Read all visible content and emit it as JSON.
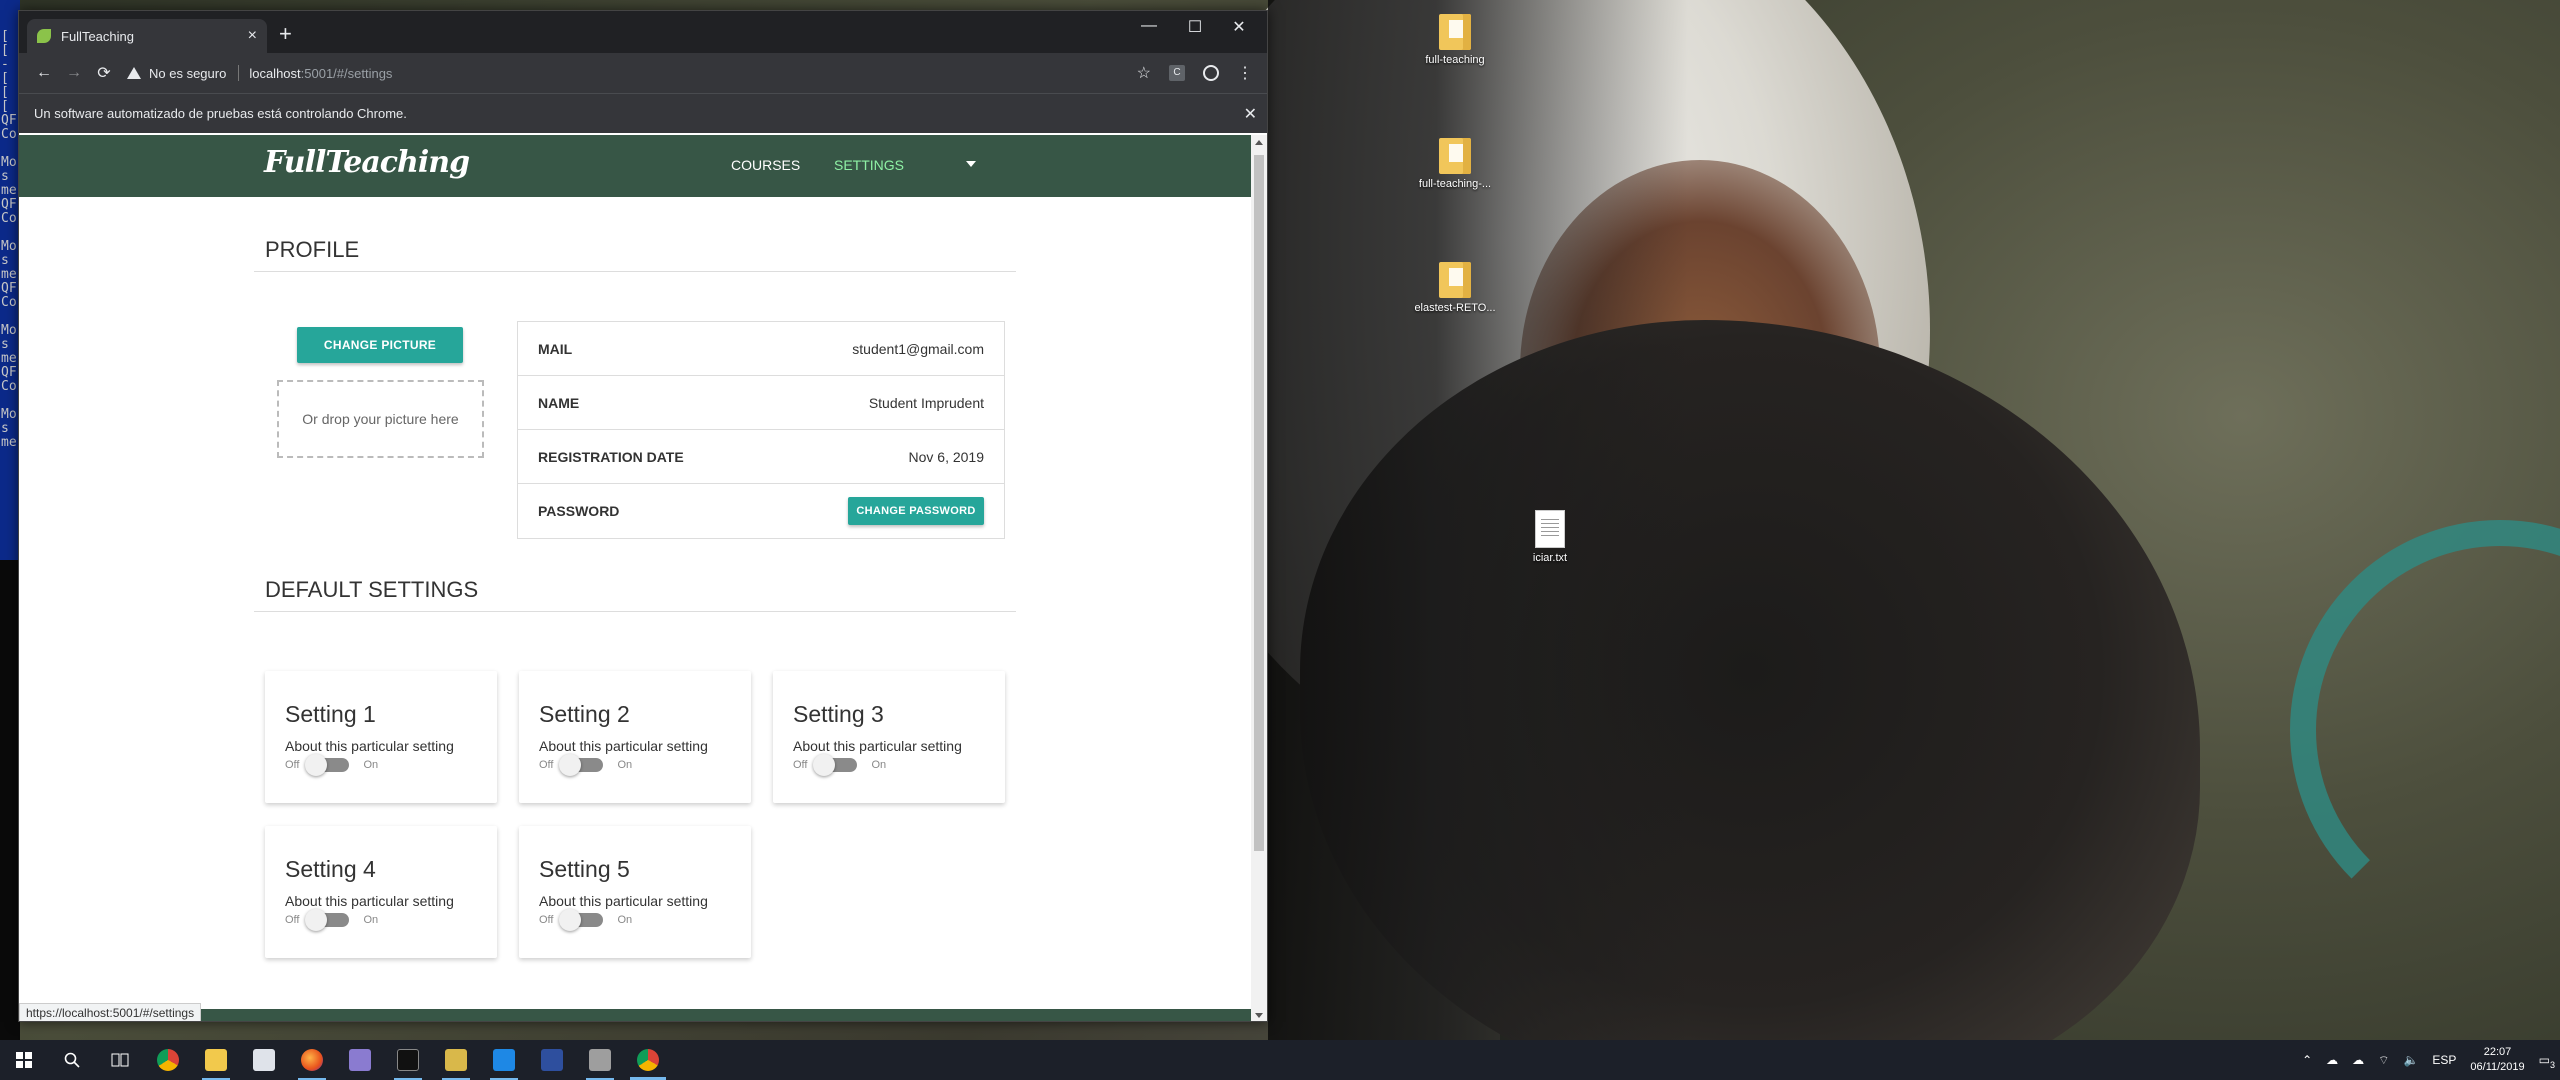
{
  "console": {
    "lines": [
      "[",
      "[",
      "-",
      "[",
      "[",
      "[",
      "QF",
      "Co",
      "",
      "Mo",
      "s",
      "me",
      "QF",
      "Co",
      "",
      "Mo",
      "s",
      "me",
      "QF",
      "Co",
      "",
      "Mo",
      "s",
      "me",
      "QF",
      "Co",
      "",
      "Mo",
      "s",
      "me"
    ]
  },
  "desktop": {
    "icons": [
      {
        "label": "full-teaching",
        "icon": "folder-icon"
      },
      {
        "label": "full-teaching-...",
        "icon": "folder-icon"
      },
      {
        "label": "elastest-RETO...",
        "icon": "folder-icon"
      },
      {
        "label": "iciar.txt",
        "icon": "text-file-icon"
      }
    ]
  },
  "browser": {
    "tab_title": "FullTeaching",
    "tab_close": "×",
    "new_tab": "+",
    "window_controls": {
      "minimize": "—",
      "maximize": "☐",
      "close": "✕"
    },
    "toolbar": {
      "back": "←",
      "forward": "→",
      "reload": "⟳",
      "security_text": "No es seguro",
      "url_host": "localhost",
      "url_path": ":5001/#/settings",
      "bookmark": "☆",
      "extension": "C",
      "menu": "⋮"
    },
    "infobar": {
      "text": "Un software automatizado de pruebas está controlando Chrome.",
      "close": "✕"
    },
    "status_url": "https://localhost:5001/#/settings"
  },
  "app": {
    "logo": "FullTeaching",
    "nav": {
      "courses": "COURSES",
      "settings": "SETTINGS"
    },
    "profile": {
      "title": "PROFILE",
      "change_picture": "CHANGE PICTURE",
      "drop_text": "Or drop your picture here",
      "rows": [
        {
          "label": "MAIL",
          "value": "student1@gmail.com"
        },
        {
          "label": "NAME",
          "value": "Student Imprudent"
        },
        {
          "label": "REGISTRATION DATE",
          "value": "Nov 6, 2019"
        }
      ],
      "password_label": "PASSWORD",
      "change_password": "CHANGE PASSWORD"
    },
    "default_settings": {
      "title": "DEFAULT SETTINGS",
      "off_label": "Off",
      "on_label": "On",
      "cards": [
        {
          "title": "Setting 1",
          "desc": "About this particular setting",
          "enabled": false
        },
        {
          "title": "Setting 2",
          "desc": "About this particular setting",
          "enabled": false
        },
        {
          "title": "Setting 3",
          "desc": "About this particular setting",
          "enabled": false
        },
        {
          "title": "Setting 4",
          "desc": "About this particular setting",
          "enabled": false
        },
        {
          "title": "Setting 5",
          "desc": "About this particular setting",
          "enabled": false
        }
      ]
    }
  },
  "taskbar": {
    "tray": {
      "language": "ESP",
      "time": "22:07",
      "date": "06/11/2019",
      "notifications": "3"
    }
  },
  "colors": {
    "appbar": "#375646",
    "accent_teal": "#26a69a",
    "active_nav": "#8ef0a4"
  }
}
